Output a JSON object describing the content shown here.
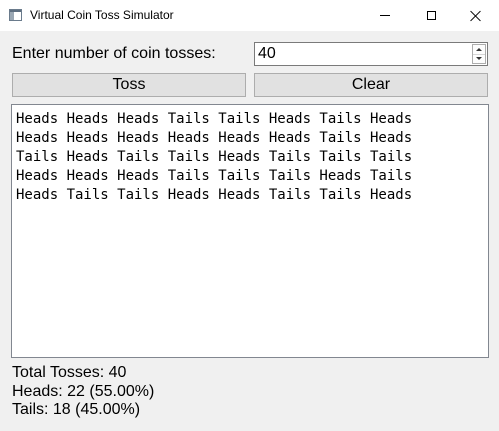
{
  "window": {
    "title": "Virtual Coin Toss Simulator"
  },
  "form": {
    "prompt_label": "Enter number of coin tosses:",
    "toss_count_value": "40",
    "toss_button_label": "Toss",
    "clear_button_label": "Clear"
  },
  "output": {
    "lines": [
      "Heads Heads Heads Tails Tails Heads Tails Heads",
      "Heads Heads Heads Heads Heads Heads Tails Heads",
      "Tails Heads Tails Tails Heads Tails Tails Tails",
      "Heads Heads Heads Tails Tails Tails Heads Tails",
      "Heads Tails Tails Heads Heads Tails Tails Heads"
    ]
  },
  "stats": {
    "total": "Total Tosses: 40",
    "heads": "Heads: 22 (55.00%)",
    "tails": "Tails: 18 (45.00%)"
  },
  "icons": {
    "app": "app-window-icon",
    "minimize": "minimize-icon",
    "maximize": "maximize-icon",
    "close": "close-icon",
    "spin_up": "chevron-up-icon",
    "spin_down": "chevron-down-icon"
  }
}
